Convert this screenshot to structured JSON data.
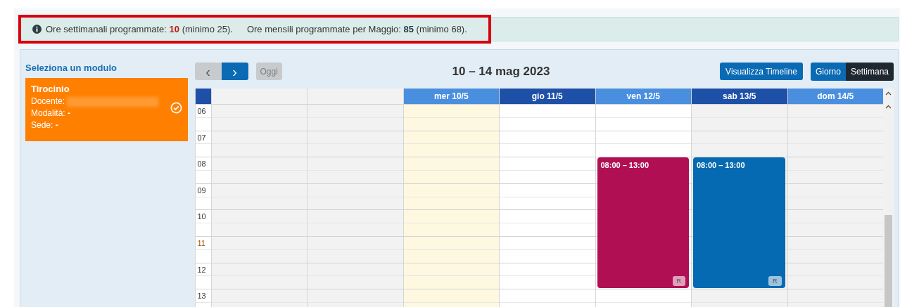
{
  "notice": {
    "items": [
      {
        "label": "Ore settimanali programmate:",
        "value": "10",
        "note": "(minimo 25).",
        "below_minimum": true
      },
      {
        "label": "Ore mensili programmate per Maggio:",
        "value": "85",
        "note": "(minimo 68).",
        "below_minimum": false
      }
    ]
  },
  "sidebar": {
    "title": "Seleziona un modulo",
    "modules": [
      {
        "name": "Tirocinio",
        "teacher": {
          "label": "Docente:",
          "redacted": true
        },
        "fields": [
          "Modalità: **-**",
          "Sede: **-**"
        ],
        "selected": true
      }
    ]
  },
  "toolbar": {
    "prev": "‹",
    "next": "›",
    "today": {
      "label": "Oggi",
      "disabled": true
    },
    "title": "10 – 14 mag 2023",
    "timeline_button": "Visualizza Timeline",
    "views": [
      {
        "label": "Giorno",
        "selected": false
      },
      {
        "label": "Settimana",
        "selected": true
      }
    ]
  },
  "calendar": {
    "columns": [
      {
        "kind": "off"
      },
      {
        "kind": "off"
      },
      {
        "kind": "today",
        "label": "mer 10/5"
      },
      {
        "kind": "open",
        "label": "gio 11/5"
      },
      {
        "kind": "open",
        "label": "ven 12/5",
        "events": [
          {
            "time": "08:00 – 13:00",
            "badge": "R",
            "color": "#b01053"
          }
        ]
      },
      {
        "kind": "off",
        "label": "sab 13/5",
        "events": [
          {
            "time": "08:00 – 13:00",
            "badge": "R",
            "color": "#066ab2"
          }
        ]
      },
      {
        "kind": "off",
        "label": "dom 14/5"
      }
    ],
    "hours": [
      {
        "label": "06",
        "current": false
      },
      {
        "label": "07",
        "current": false
      },
      {
        "label": "08",
        "current": false
      },
      {
        "label": "09",
        "current": false
      },
      {
        "label": "10",
        "current": false
      },
      {
        "label": "11",
        "current": true
      },
      {
        "label": "12",
        "current": false
      },
      {
        "label": "13",
        "current": false
      }
    ]
  }
}
